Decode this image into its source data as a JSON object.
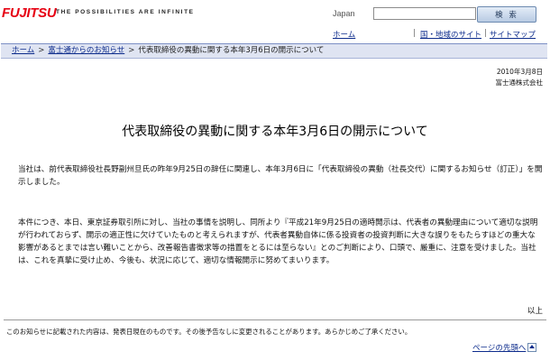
{
  "header": {
    "logo_text": "FUJITSU",
    "tagline": "THE POSSIBILITIES ARE INFINITE",
    "region": "Japan",
    "search_button": "検 索",
    "home_link": "ホーム",
    "region_link": "国・地域のサイト",
    "separator": "|",
    "sitemap_link": "サイトマップ"
  },
  "breadcrumb": {
    "separator": ">",
    "items": [
      "ホーム",
      "富士通からのお知らせ"
    ],
    "current": "代表取締役の異動に関する本年3月6日の開示について"
  },
  "article": {
    "date": "2010年3月8日",
    "company": "富士通株式会社",
    "title": "代表取締役の異動に関する本年3月6日の開示について",
    "paragraph1": "当社は、前代表取締役社長野副州旦氏の昨年9月25日の辞任に関連し、本年3月6日に「代表取締役の異動（社長交代）に関するお知らせ（訂正）」を開示しました。",
    "paragraph2": "本件につき、本日、東京証券取引所に対し、当社の事情を説明し、同所より『平成21年9月25日の適時開示は、代表者の異動理由について適切な説明が行われておらず、開示の適正性に欠けていたものと考えられますが、代表者異動自体に係る投資者の投資判断に大きな誤りをもたらすほどの重大な影響があるとまでは言い難いことから、改善報告書徴求等の措置をとるには至らない』とのご判断により、口頭で、厳重に、注意を受けました。当社は、これを真摯に受け止め、今後も、状況に応じて、適切な情報開示に努めてまいります。",
    "closing": "以上"
  },
  "footer": {
    "notice": "このお知らせに記載された内容は、発表日現在のものです。その後予告なしに変更されることがあります。あらかじめご了承ください。",
    "page_top": "ページの先頭へ"
  },
  "colors": {
    "brand_red": "#e60012",
    "link_blue": "#0d2c8c",
    "breadcrumb_bg": "#dfe4f2"
  }
}
